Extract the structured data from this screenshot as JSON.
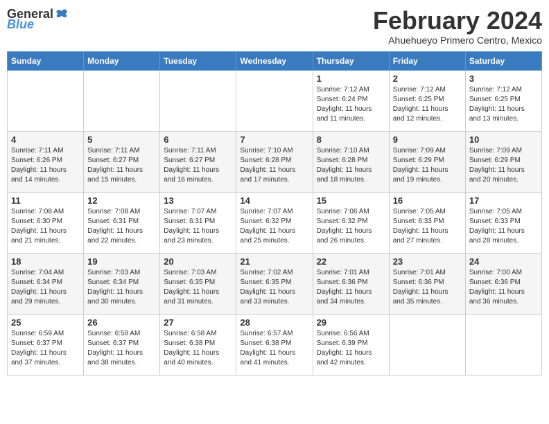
{
  "header": {
    "logo": {
      "general": "General",
      "blue": "Blue"
    },
    "month": "February 2024",
    "location": "Ahuehueyo Primero Centro, Mexico"
  },
  "days_of_week": [
    "Sunday",
    "Monday",
    "Tuesday",
    "Wednesday",
    "Thursday",
    "Friday",
    "Saturday"
  ],
  "weeks": [
    {
      "days": [
        {
          "number": "",
          "info": ""
        },
        {
          "number": "",
          "info": ""
        },
        {
          "number": "",
          "info": ""
        },
        {
          "number": "",
          "info": ""
        },
        {
          "number": "1",
          "info": "Sunrise: 7:12 AM\nSunset: 6:24 PM\nDaylight: 11 hours\nand 11 minutes."
        },
        {
          "number": "2",
          "info": "Sunrise: 7:12 AM\nSunset: 6:25 PM\nDaylight: 11 hours\nand 12 minutes."
        },
        {
          "number": "3",
          "info": "Sunrise: 7:12 AM\nSunset: 6:25 PM\nDaylight: 11 hours\nand 13 minutes."
        }
      ]
    },
    {
      "days": [
        {
          "number": "4",
          "info": "Sunrise: 7:11 AM\nSunset: 6:26 PM\nDaylight: 11 hours\nand 14 minutes."
        },
        {
          "number": "5",
          "info": "Sunrise: 7:11 AM\nSunset: 6:27 PM\nDaylight: 11 hours\nand 15 minutes."
        },
        {
          "number": "6",
          "info": "Sunrise: 7:11 AM\nSunset: 6:27 PM\nDaylight: 11 hours\nand 16 minutes."
        },
        {
          "number": "7",
          "info": "Sunrise: 7:10 AM\nSunset: 6:28 PM\nDaylight: 11 hours\nand 17 minutes."
        },
        {
          "number": "8",
          "info": "Sunrise: 7:10 AM\nSunset: 6:28 PM\nDaylight: 11 hours\nand 18 minutes."
        },
        {
          "number": "9",
          "info": "Sunrise: 7:09 AM\nSunset: 6:29 PM\nDaylight: 11 hours\nand 19 minutes."
        },
        {
          "number": "10",
          "info": "Sunrise: 7:09 AM\nSunset: 6:29 PM\nDaylight: 11 hours\nand 20 minutes."
        }
      ]
    },
    {
      "days": [
        {
          "number": "11",
          "info": "Sunrise: 7:08 AM\nSunset: 6:30 PM\nDaylight: 11 hours\nand 21 minutes."
        },
        {
          "number": "12",
          "info": "Sunrise: 7:08 AM\nSunset: 6:31 PM\nDaylight: 11 hours\nand 22 minutes."
        },
        {
          "number": "13",
          "info": "Sunrise: 7:07 AM\nSunset: 6:31 PM\nDaylight: 11 hours\nand 23 minutes."
        },
        {
          "number": "14",
          "info": "Sunrise: 7:07 AM\nSunset: 6:32 PM\nDaylight: 11 hours\nand 25 minutes."
        },
        {
          "number": "15",
          "info": "Sunrise: 7:06 AM\nSunset: 6:32 PM\nDaylight: 11 hours\nand 26 minutes."
        },
        {
          "number": "16",
          "info": "Sunrise: 7:05 AM\nSunset: 6:33 PM\nDaylight: 11 hours\nand 27 minutes."
        },
        {
          "number": "17",
          "info": "Sunrise: 7:05 AM\nSunset: 6:33 PM\nDaylight: 11 hours\nand 28 minutes."
        }
      ]
    },
    {
      "days": [
        {
          "number": "18",
          "info": "Sunrise: 7:04 AM\nSunset: 6:34 PM\nDaylight: 11 hours\nand 29 minutes."
        },
        {
          "number": "19",
          "info": "Sunrise: 7:03 AM\nSunset: 6:34 PM\nDaylight: 11 hours\nand 30 minutes."
        },
        {
          "number": "20",
          "info": "Sunrise: 7:03 AM\nSunset: 6:35 PM\nDaylight: 11 hours\nand 31 minutes."
        },
        {
          "number": "21",
          "info": "Sunrise: 7:02 AM\nSunset: 6:35 PM\nDaylight: 11 hours\nand 33 minutes."
        },
        {
          "number": "22",
          "info": "Sunrise: 7:01 AM\nSunset: 6:36 PM\nDaylight: 11 hours\nand 34 minutes."
        },
        {
          "number": "23",
          "info": "Sunrise: 7:01 AM\nSunset: 6:36 PM\nDaylight: 11 hours\nand 35 minutes."
        },
        {
          "number": "24",
          "info": "Sunrise: 7:00 AM\nSunset: 6:36 PM\nDaylight: 11 hours\nand 36 minutes."
        }
      ]
    },
    {
      "days": [
        {
          "number": "25",
          "info": "Sunrise: 6:59 AM\nSunset: 6:37 PM\nDaylight: 11 hours\nand 37 minutes."
        },
        {
          "number": "26",
          "info": "Sunrise: 6:58 AM\nSunset: 6:37 PM\nDaylight: 11 hours\nand 38 minutes."
        },
        {
          "number": "27",
          "info": "Sunrise: 6:58 AM\nSunset: 6:38 PM\nDaylight: 11 hours\nand 40 minutes."
        },
        {
          "number": "28",
          "info": "Sunrise: 6:57 AM\nSunset: 6:38 PM\nDaylight: 11 hours\nand 41 minutes."
        },
        {
          "number": "29",
          "info": "Sunrise: 6:56 AM\nSunset: 6:39 PM\nDaylight: 11 hours\nand 42 minutes."
        },
        {
          "number": "",
          "info": ""
        },
        {
          "number": "",
          "info": ""
        }
      ]
    }
  ]
}
